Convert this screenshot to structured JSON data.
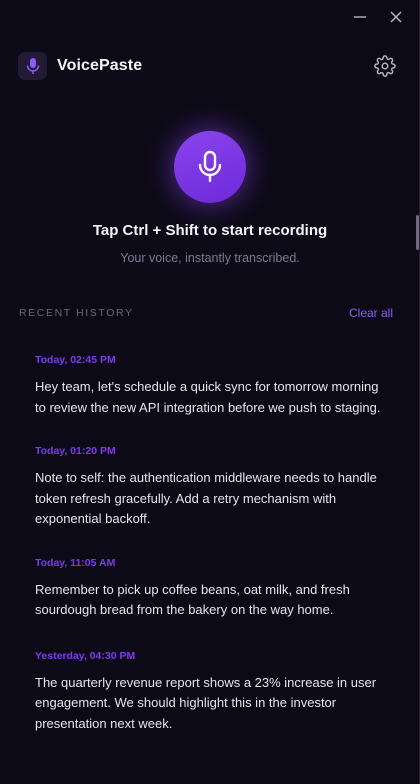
{
  "app": {
    "title": "VoicePaste"
  },
  "window_controls": {
    "minimize_icon": "minimize-icon",
    "close_icon": "close-icon"
  },
  "header": {
    "logo_icon": "microphone-icon",
    "settings_icon": "gear-icon"
  },
  "recorder": {
    "icon": "microphone-icon",
    "prompt": "Tap Ctrl + Shift to start recording",
    "subtitle": "Your voice, instantly transcribed."
  },
  "history": {
    "title": "RECENT HISTORY",
    "clear_label": "Clear all",
    "items": [
      {
        "time": "Today, 02:45 PM",
        "text": "Hey team, let's schedule a quick sync for tomorrow morning to review the new API integration before we push to staging."
      },
      {
        "time": "Today, 01:20 PM",
        "text": "Note to self: the authentication middleware needs to handle token refresh gracefully. Add a retry mechanism with exponential backoff."
      },
      {
        "time": "Today, 11:05 AM",
        "text": "Remember to pick up coffee beans, oat milk, and fresh sourdough bread from the bakery on the way home."
      },
      {
        "time": "Yesterday, 04:30 PM",
        "text": "The quarterly revenue report shows a 23% increase in user engagement. We should highlight this in the investor presentation next week."
      }
    ]
  },
  "colors": {
    "background": "#0d0a17",
    "accent": "#7c3aed",
    "accent_light": "#8b5cf6",
    "text": "#e6e4ee",
    "muted": "#7f7891"
  }
}
